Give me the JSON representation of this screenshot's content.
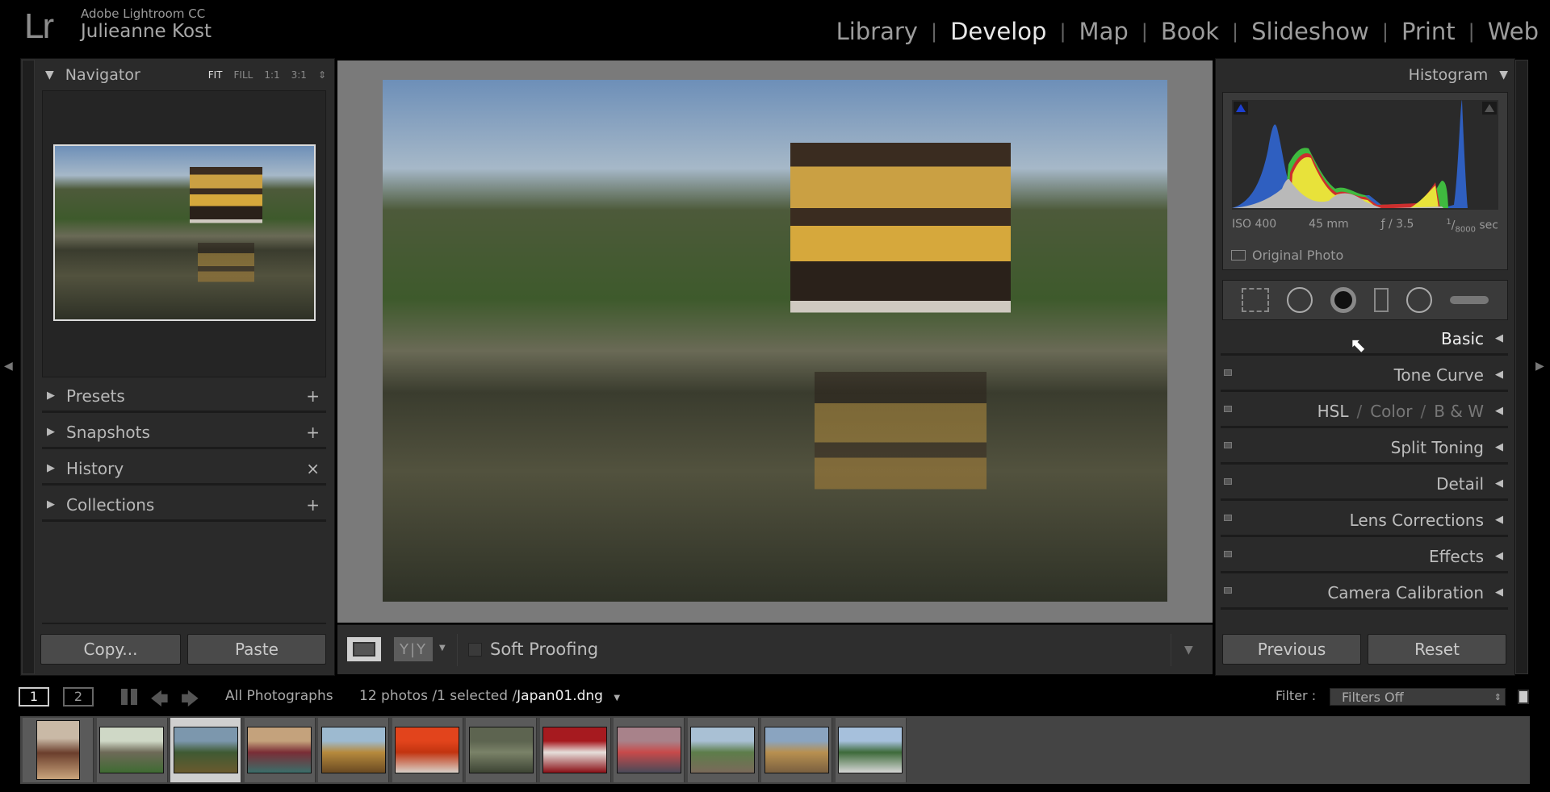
{
  "app": {
    "logo": "Lr",
    "name": "Adobe Lightroom CC",
    "user": "Julieanne Kost"
  },
  "modules": [
    {
      "label": "Library",
      "active": false
    },
    {
      "label": "Develop",
      "active": true
    },
    {
      "label": "Map",
      "active": false
    },
    {
      "label": "Book",
      "active": false
    },
    {
      "label": "Slideshow",
      "active": false
    },
    {
      "label": "Print",
      "active": false
    },
    {
      "label": "Web",
      "active": false
    }
  ],
  "left_panel": {
    "navigator": {
      "title": "Navigator",
      "zoom_options": [
        "FIT",
        "FILL",
        "1:1",
        "3:1"
      ],
      "selected_zoom": "FIT"
    },
    "sections": [
      {
        "label": "Presets",
        "action": "+"
      },
      {
        "label": "Snapshots",
        "action": "+"
      },
      {
        "label": "History",
        "action": "×"
      },
      {
        "label": "Collections",
        "action": "+"
      }
    ],
    "copy_label": "Copy...",
    "paste_label": "Paste"
  },
  "toolbar": {
    "soft_proofing_label": "Soft Proofing",
    "soft_proofing_checked": false,
    "compare_label": "Y|Y"
  },
  "right_panel": {
    "histogram": {
      "title": "Histogram",
      "iso": "ISO 400",
      "focal": "45 mm",
      "aperture": "ƒ / 3.5",
      "shutter_num": "1",
      "shutter_den": "8000",
      "shutter_unit": "sec",
      "original_photo_label": "Original Photo"
    },
    "tools": [
      "crop-overlay-icon",
      "spot-removal-icon",
      "red-eye-icon",
      "graduated-filter-icon",
      "radial-filter-icon",
      "adjustment-brush-icon"
    ],
    "sections": [
      {
        "label": "Basic",
        "toggle": false
      },
      {
        "label": "Tone Curve",
        "toggle": true
      },
      {
        "label": "HSL",
        "label2": "Color",
        "label3": "B & W",
        "toggle": true
      },
      {
        "label": "Split Toning",
        "toggle": true
      },
      {
        "label": "Detail",
        "toggle": true
      },
      {
        "label": "Lens Corrections",
        "toggle": true
      },
      {
        "label": "Effects",
        "toggle": true
      },
      {
        "label": "Camera Calibration",
        "toggle": true
      }
    ],
    "previous_label": "Previous",
    "reset_label": "Reset"
  },
  "filmstrip": {
    "monitor1": "1",
    "monitor2": "2",
    "source": "All Photographs",
    "count_text": "12 photos /1 selected /",
    "filename": "Japan01.dng",
    "filter_label": "Filter :",
    "filter_value": "Filters Off",
    "thumbnails": [
      {
        "colors": [
          "#c9b9a6",
          "#6b3e2c",
          "#c9a47c"
        ]
      },
      {
        "colors": [
          "#cfd8c6",
          "#6e6a58",
          "#3f6b33"
        ]
      },
      {
        "colors": [
          "#7c97ad",
          "#3f5a33",
          "#6a5a2e"
        ],
        "selected": true
      },
      {
        "colors": [
          "#c4a27c",
          "#7a2d36",
          "#3b6e6a"
        ]
      },
      {
        "colors": [
          "#9dbad0",
          "#b68a3d",
          "#6a4a22"
        ]
      },
      {
        "colors": [
          "#e2441c",
          "#c23410",
          "#d8d0c8"
        ]
      },
      {
        "colors": [
          "#5d6450",
          "#7a8268",
          "#3d4434"
        ]
      },
      {
        "colors": [
          "#a61a1f",
          "#e6e0dc",
          "#8a1016"
        ]
      },
      {
        "colors": [
          "#a8828a",
          "#c84a4a",
          "#4a4a58"
        ]
      },
      {
        "colors": [
          "#a9c0d4",
          "#5d7d4a",
          "#7a6a5a"
        ]
      },
      {
        "colors": [
          "#8aa4c0",
          "#b89050",
          "#7a6040"
        ]
      },
      {
        "colors": [
          "#a6c0dc",
          "#3d6a3a",
          "#d6d6d6"
        ]
      }
    ]
  },
  "colors": {
    "accent_text": "#e8e8e8",
    "panel": "#2a2a2a",
    "canvas": "#7a7a7a"
  }
}
